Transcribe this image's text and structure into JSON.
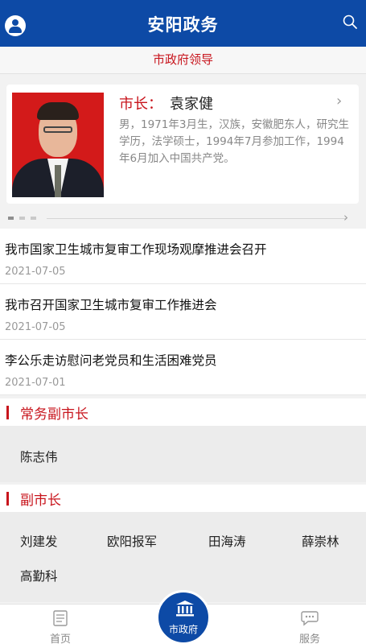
{
  "header": {
    "title": "安阳政务",
    "subtitle": "市政府领导"
  },
  "leader": {
    "role": "市长：",
    "name": "袁家健",
    "bio": "男，1971年3月生，汉族，安徽肥东人，研究生学历，法学硕士，1994年7月参加工作，1994年6月加入中国共产党。"
  },
  "news": [
    {
      "title": "我市国家卫生城市复审工作现场观摩推进会召开",
      "date": "2021-07-05"
    },
    {
      "title": "我市召开国家卫生城市复审工作推进会",
      "date": "2021-07-05"
    },
    {
      "title": "李公乐走访慰问老党员和生活困难党员",
      "date": "2021-07-01"
    }
  ],
  "executive_vice_mayor": {
    "heading": "常务副市长",
    "names": [
      "陈志伟"
    ]
  },
  "vice_mayors": {
    "heading": "副市长",
    "names": [
      "刘建发",
      "欧阳报军",
      "田海涛",
      "薛崇林",
      "高勤科"
    ]
  },
  "tabbar": {
    "home": "首页",
    "center": "市政府",
    "service": "服务"
  },
  "colors": {
    "brand_blue": "#0d4aa6",
    "accent_red": "#c8151d"
  },
  "icons": [
    "user-icon",
    "search-icon",
    "chevron-right-icon",
    "home-doc-icon",
    "government-building-icon",
    "chat-icon"
  ]
}
